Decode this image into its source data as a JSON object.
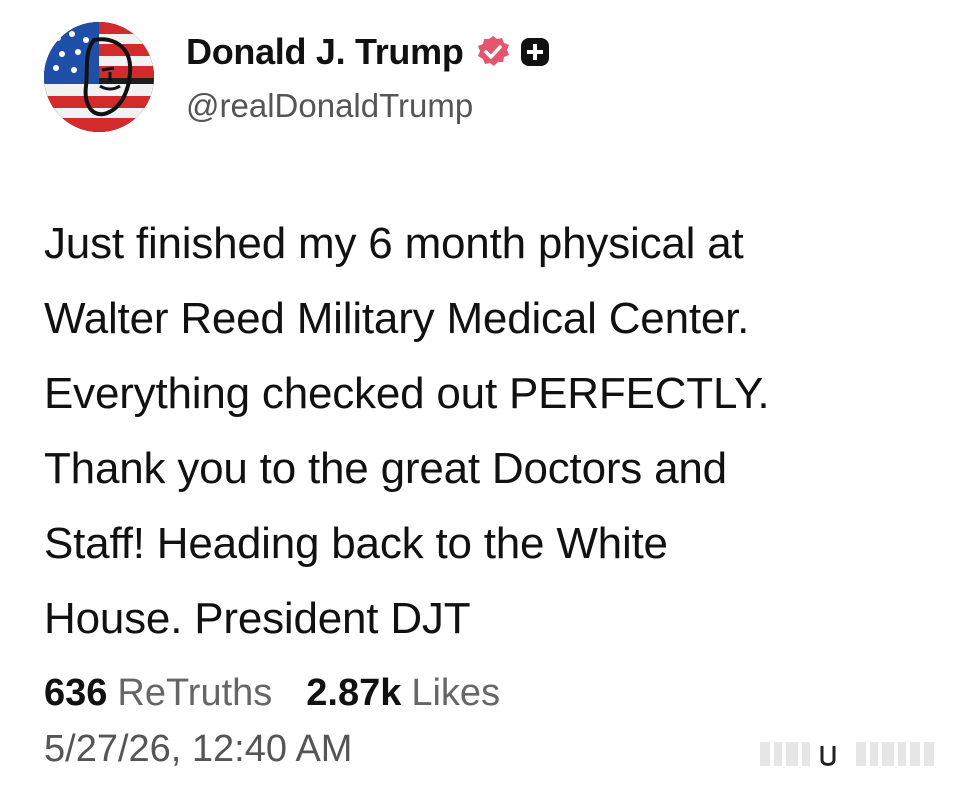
{
  "author": {
    "display_name": "Donald J. Trump",
    "handle": "@realDonaldTrump",
    "avatar_icon": "flag-portrait-avatar",
    "verified_icon": "verified-badge-icon",
    "plus_icon": "plus-badge-icon"
  },
  "post": {
    "text": "Just finished my 6 month physical at\nWalter Reed Military Medical Center.\nEverything checked out PERFECTLY.\nThank you to the great Doctors and\nStaff! Heading back to the White\nHouse. President DJT"
  },
  "stats": {
    "retruths_count": "636",
    "retruths_label": "ReTruths",
    "likes_count": "2.87k",
    "likes_label": "Likes"
  },
  "timestamp": "5/27/26, 12:40 AM",
  "colors": {
    "verified": "#e4566e",
    "text": "#111111",
    "muted": "#666666"
  }
}
